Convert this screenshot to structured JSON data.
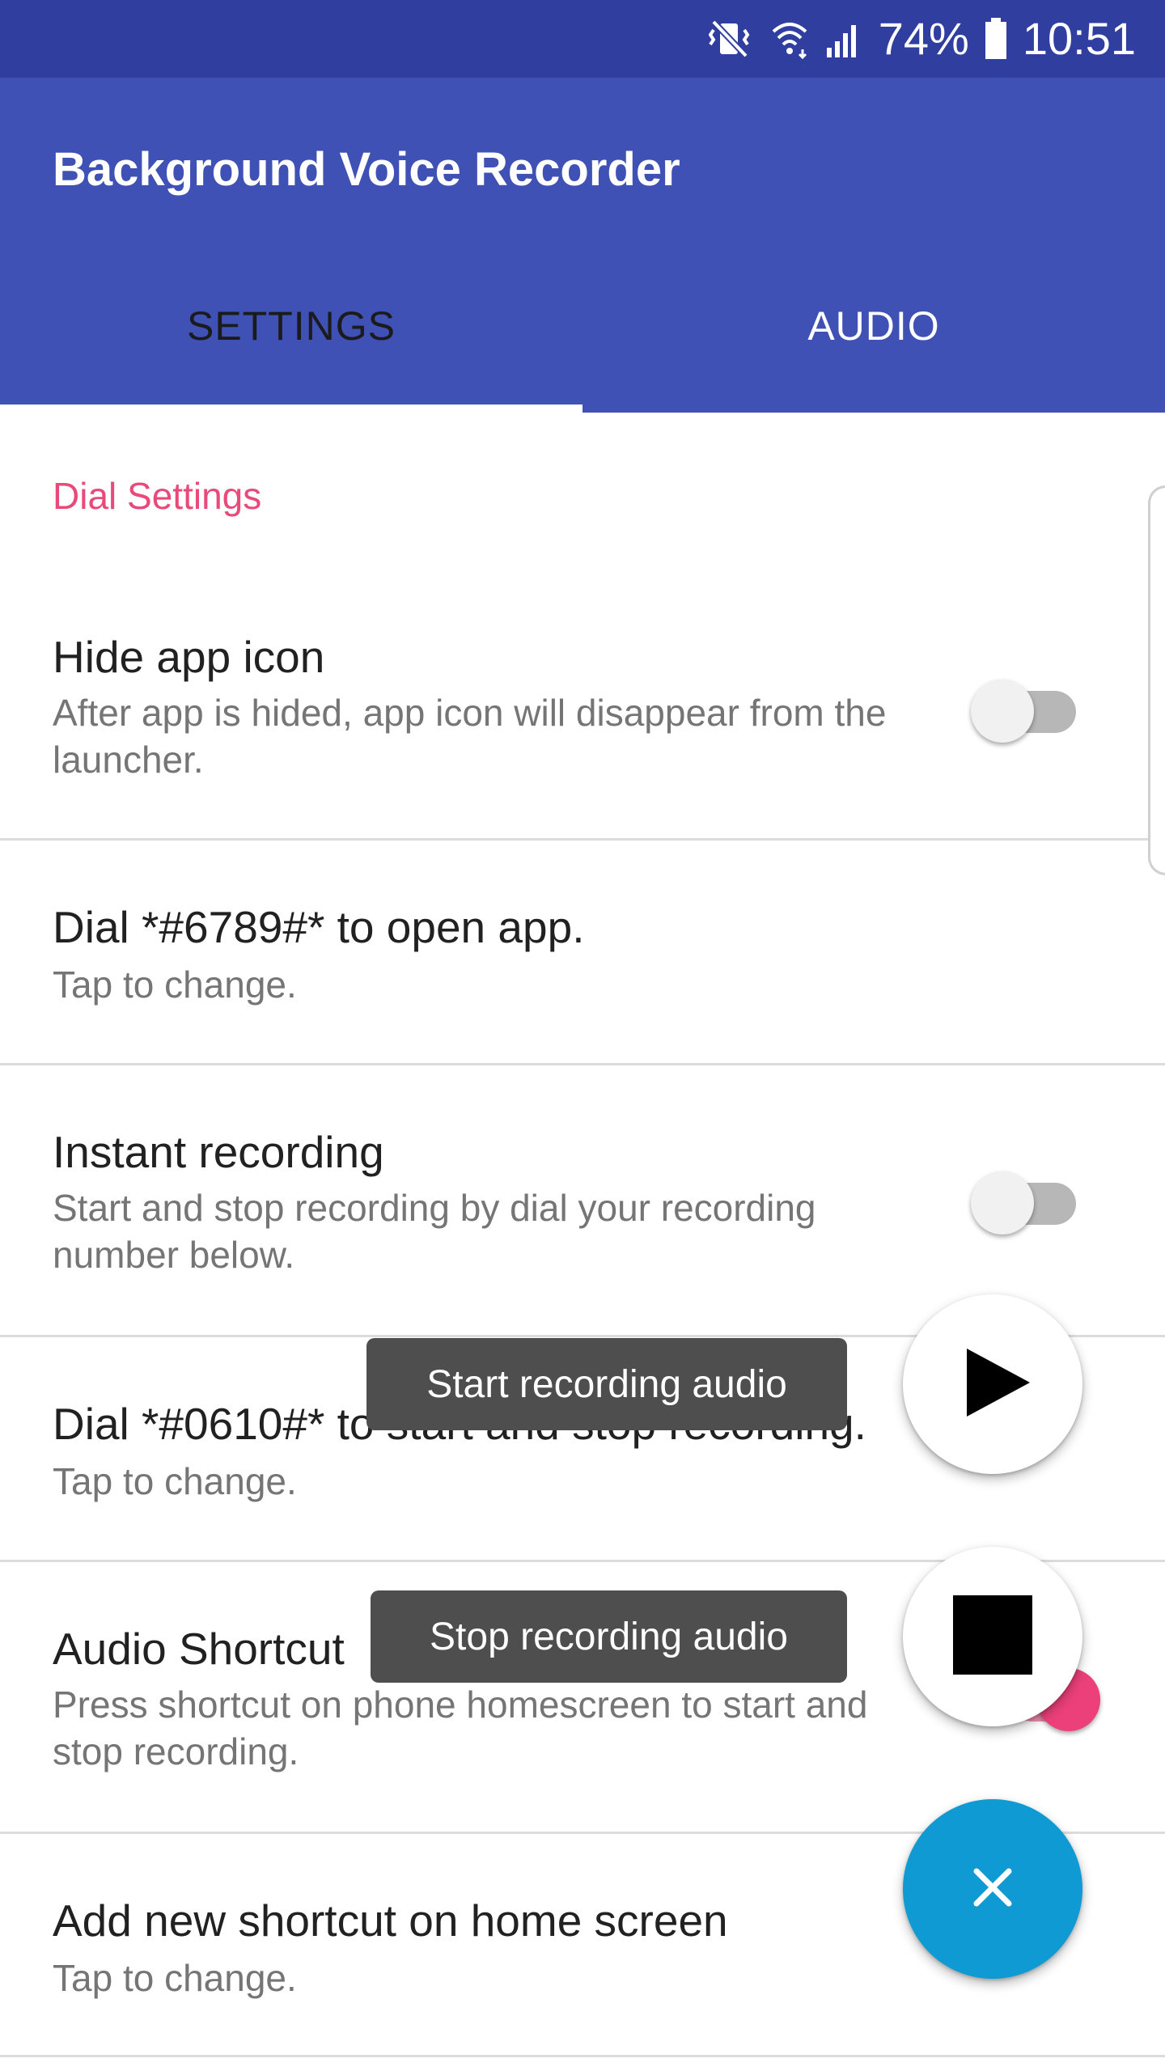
{
  "status_bar": {
    "battery_percent": "74%",
    "time": "10:51",
    "icons": [
      "mute-vibrate-icon",
      "wifi-icon",
      "signal-icon",
      "battery-icon"
    ]
  },
  "app_bar": {
    "title": "Background Voice Recorder",
    "tabs": [
      {
        "label": "SETTINGS",
        "selected": true
      },
      {
        "label": "AUDIO",
        "selected": false
      }
    ]
  },
  "section": {
    "header": "Dial Settings"
  },
  "settings": [
    {
      "title": "Hide app icon",
      "subtitle": "After app is hided, app icon will disappear from the launcher.",
      "switch_on": false
    },
    {
      "title": "Dial *#6789#* to open app.",
      "subtitle": "Tap to change."
    },
    {
      "title": "Instant recording",
      "subtitle": "Start and stop recording by dial your recording number below.",
      "switch_on": false
    },
    {
      "title": "Dial *#0610#* to start and stop recording.",
      "subtitle": "Tap to change."
    },
    {
      "title": "Audio Shortcut",
      "subtitle": "Press shortcut on phone homescreen to start and stop recording.",
      "switch_on": true
    },
    {
      "title": "Add new shortcut on home screen",
      "subtitle": "Tap to change."
    }
  ],
  "fab_menu": {
    "start": {
      "tooltip": "Start recording audio",
      "icon": "play-icon"
    },
    "stop": {
      "tooltip": "Stop recording audio",
      "icon": "stop-icon"
    },
    "main": {
      "icon": "close-icon"
    }
  },
  "colors": {
    "status_bar": "#303f9f",
    "primary": "#3f51b5",
    "accent": "#e84a7a",
    "fab": "#0f9ad3"
  }
}
